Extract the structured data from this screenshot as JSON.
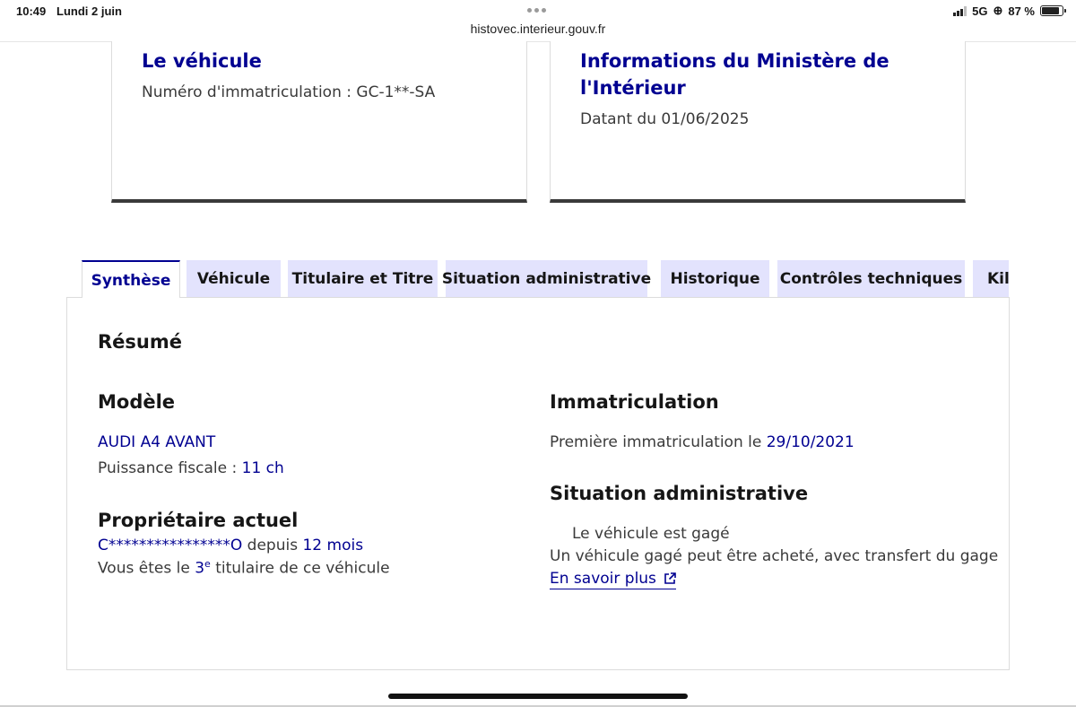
{
  "status_bar": {
    "time": "10:49",
    "date": "Lundi 2 juin",
    "url": "histovec.interieur.gouv.fr",
    "network": "5G",
    "battery": "87 %"
  },
  "cards": {
    "vehicle": {
      "title": "Le véhicule",
      "plate_label": "Numéro d'immatriculation : GC-1**-SA"
    },
    "ministry": {
      "title_line1": "Informations du Ministère de",
      "title_line2": "l'Intérieur",
      "date_label": "Datant du 01/06/2025"
    }
  },
  "tabs": {
    "synthese": "Synthèse",
    "vehicule": "Véhicule",
    "titulaire": "Titulaire et Titre",
    "situation": "Situation administrative",
    "historique": "Historique",
    "controles": "Contrôles techniques",
    "kilometrage": "Kilo"
  },
  "summary": {
    "title": "Résumé",
    "model": {
      "heading": "Modèle",
      "name": "AUDI A4 AVANT",
      "power_label": "Puissance fiscale : ",
      "power_value": "11 ch"
    },
    "owner": {
      "heading": "Propriétaire actuel",
      "name": "C****************O",
      "since_label": " depuis ",
      "since_value": "12 mois",
      "rank_prefix": "Vous êtes le ",
      "rank_number": "3",
      "rank_sup": "e",
      "rank_suffix": " titulaire de ce véhicule"
    },
    "registration": {
      "heading": "Immatriculation",
      "first_label": "Première immatriculation le ",
      "first_date": "29/10/2021"
    },
    "admin": {
      "heading": "Situation administrative",
      "status": "Le véhicule est gagé",
      "note": "Un véhicule gagé peut être acheté, avec transfert du gage",
      "link": "En savoir plus"
    }
  }
}
